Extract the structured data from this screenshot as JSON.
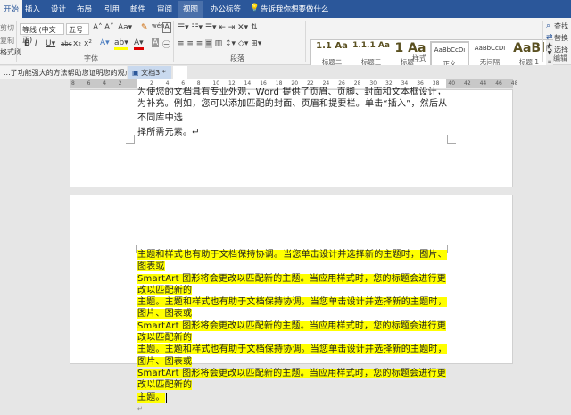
{
  "tabs": [
    "开始",
    "插入",
    "设计",
    "布局",
    "引用",
    "邮件",
    "审阅",
    "视图",
    "办公标签"
  ],
  "tell_me": "告诉我你想要做什么",
  "clipboard": [
    "剪切",
    "复制",
    "格式刷"
  ],
  "font": {
    "name": "等线 (中文正)",
    "size": "五号",
    "label": "字体"
  },
  "paragraph": {
    "label": "段落"
  },
  "styles": {
    "label": "样式",
    "items": [
      {
        "preview": "1.1 Aa",
        "name": "标题二"
      },
      {
        "preview": "1.1.1 Aa",
        "name": "标题三"
      },
      {
        "preview": "1 Aa",
        "name": "标题一"
      },
      {
        "preview": "AaBbCcDı",
        "name": "正文"
      },
      {
        "preview": "AaBbCcDı",
        "name": "无间隔"
      },
      {
        "preview": "AaBl",
        "name": "标题 1"
      }
    ]
  },
  "editing": {
    "label": "编辑",
    "find": "查找",
    "replace": "替换",
    "select": "选择"
  },
  "doc_tabs": [
    "...了功能强大的方法帮助您证明您的观点.docx",
    "文档3 *"
  ],
  "ruler": [
    "8",
    "6",
    "4",
    "2",
    "",
    "2",
    "4",
    "6",
    "8",
    "10",
    "12",
    "14",
    "16",
    "18",
    "20",
    "22",
    "24",
    "26",
    "28",
    "30",
    "32",
    "34",
    "36",
    "38",
    "40",
    "42",
    "44",
    "46",
    "48"
  ],
  "page1_lines": [
    "为使您的文档具有专业外观，Word 提供了页眉、页脚、封面和文本框设计，这些设计可互",
    "为补充。例如，您可以添加匹配的封面、页眉和提要栏。单击“插入”，然后从不同库中选",
    "择所需元素。↵"
  ],
  "page2_lines": [
    "主题和样式也有助于文档保持协调。当您单击设计并选择新的主题时，图片、图表或",
    "SmartArt 图形将会更改以匹配新的主题。当应用样式时，您的标题会进行更改以匹配新的",
    "主题。主题和样式也有助于文档保持协调。当您单击设计并选择新的主题时，图片、图表或",
    "SmartArt 图形将会更改以匹配新的主题。当应用样式时，您的标题会进行更改以匹配新的",
    "主题。主题和样式也有助于文档保持协调。当您单击设计并选择新的主题时，图片、图表或",
    "SmartArt 图形将会更改以匹配新的主题。当应用样式时，您的标题会进行更改以匹配新的",
    "主题。"
  ],
  "empty_para": "↵",
  "colors": {
    "accent": "#2b579a",
    "highlight": "#ffff00"
  }
}
